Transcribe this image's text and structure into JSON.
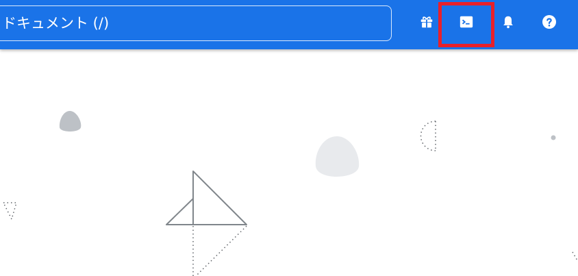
{
  "header": {
    "search_text": "ドキュメント (/)"
  },
  "icons": {
    "gift": "gift-icon",
    "terminal": "terminal-icon",
    "bell": "bell-icon",
    "help": "help-icon"
  },
  "colors": {
    "header_bg": "#1a73e8",
    "highlight": "#e8202a"
  }
}
